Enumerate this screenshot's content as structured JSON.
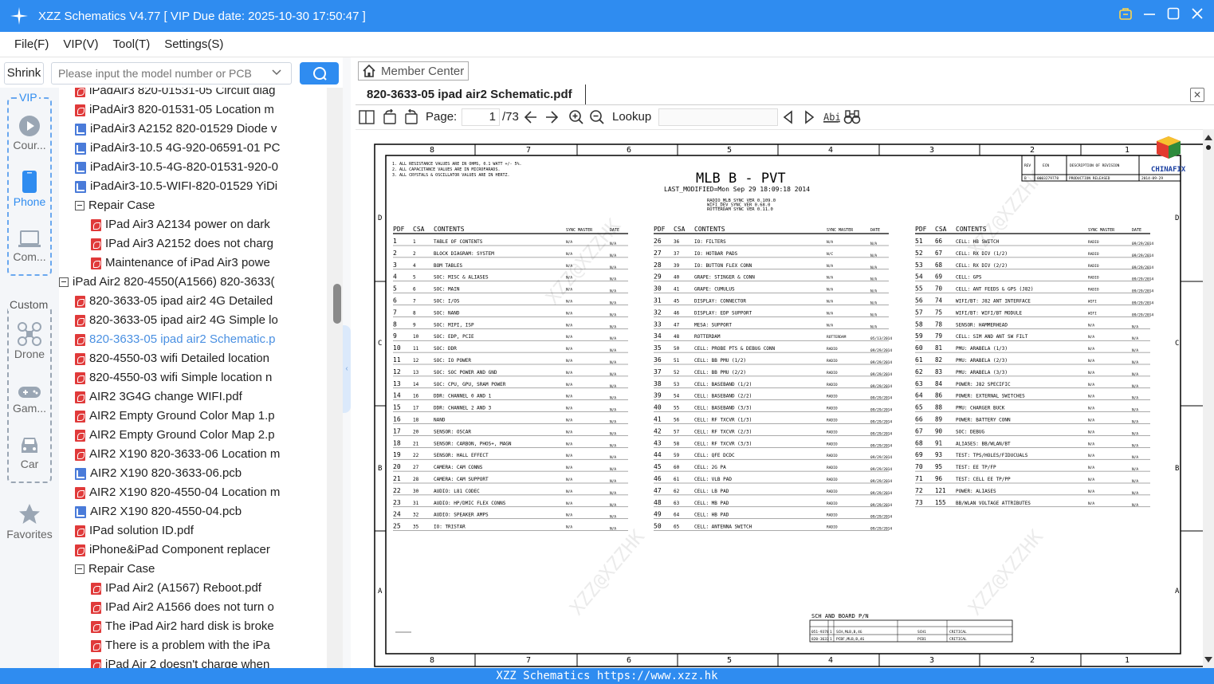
{
  "window": {
    "title": "XZZ Schematics V4.77 [ VIP Due date: 2025-10-30 17:50:47 ]"
  },
  "menu": [
    "File(F)",
    "VIP(V)",
    "Tool(T)",
    "Settings(S)"
  ],
  "search": {
    "shrink_label": "Shrink",
    "placeholder": "Please input the model number or PCB"
  },
  "sidebar": {
    "vip_label": "VIP",
    "custom_label": "Custom",
    "items": [
      {
        "label": "Cour...",
        "icon": "play-icon"
      },
      {
        "label": "Phone",
        "icon": "phone-icon"
      },
      {
        "label": "Com...",
        "icon": "laptop-icon"
      },
      {
        "label": "Drone",
        "icon": "drone-icon"
      },
      {
        "label": "Gam...",
        "icon": "gamepad-icon"
      },
      {
        "label": "Car",
        "icon": "car-icon"
      },
      {
        "label": "Favorites",
        "icon": "star-icon"
      }
    ]
  },
  "tree": {
    "rows": [
      {
        "label": "iPadAir3 820-01531-05 Circuit diag",
        "type": "pdf",
        "indent": 1
      },
      {
        "label": "iPadAir3 820-01531-05 Location m",
        "type": "pdf",
        "indent": 1
      },
      {
        "label": "iPadAir3 A2152 820-01529 Diode v",
        "type": "pcb",
        "indent": 1
      },
      {
        "label": "iPadAir3-10.5 4G-920-06591-01 PC",
        "type": "pcb",
        "indent": 1
      },
      {
        "label": "iPadAir3-10.5-4G-820-01531-920-0",
        "type": "pcb",
        "indent": 1
      },
      {
        "label": "iPadAir3-10.5-WIFI-820-01529 YiDi",
        "type": "pcb",
        "indent": 1
      },
      {
        "label": "Repair Case",
        "type": "folder",
        "indent": 1
      },
      {
        "label": "IPad Air3 A2134 power on dark",
        "type": "pdf",
        "indent": 2
      },
      {
        "label": "IPad Air3 A2152 does not charg",
        "type": "pdf",
        "indent": 2
      },
      {
        "label": "Maintenance of iPad Air3 powe",
        "type": "pdf",
        "indent": 2
      },
      {
        "label": "iPad Air2 820-4550(A1566) 820-3633(",
        "type": "folder",
        "indent": 0
      },
      {
        "label": "820-3633-05 ipad air2 4G Detailed",
        "type": "pdf",
        "indent": 1
      },
      {
        "label": "820-3633-05 ipad air2 4G Simple lo",
        "type": "pdf",
        "indent": 1
      },
      {
        "label": "820-3633-05 ipad air2 Schematic.p",
        "type": "pdf",
        "indent": 1,
        "selected": true
      },
      {
        "label": "820-4550-03 wifi Detailed location",
        "type": "pdf",
        "indent": 1
      },
      {
        "label": "820-4550-03 wifi Simple location n",
        "type": "pdf",
        "indent": 1
      },
      {
        "label": "AIR2 3G4G change WIFI.pdf",
        "type": "pdf",
        "indent": 1
      },
      {
        "label": "AIR2 Empty Ground Color Map 1.p",
        "type": "pdf",
        "indent": 1
      },
      {
        "label": "AIR2 Empty Ground Color Map 2.p",
        "type": "pdf",
        "indent": 1
      },
      {
        "label": "AIR2 X190 820-3633-06 Location m",
        "type": "pdf",
        "indent": 1
      },
      {
        "label": "AIR2 X190 820-3633-06.pcb",
        "type": "pcb",
        "indent": 1
      },
      {
        "label": "AIR2 X190 820-4550-04 Location m",
        "type": "pdf",
        "indent": 1
      },
      {
        "label": "AIR2 X190 820-4550-04.pcb",
        "type": "pcb",
        "indent": 1
      },
      {
        "label": "IPad solution ID.pdf",
        "type": "pdf",
        "indent": 1
      },
      {
        "label": "iPhone&iPad Component replacer",
        "type": "pdf",
        "indent": 1
      },
      {
        "label": "Repair Case",
        "type": "folder",
        "indent": 1
      },
      {
        "label": "IPad Air2 (A1567) Reboot.pdf",
        "type": "pdf",
        "indent": 2
      },
      {
        "label": "IPad Air2 A1566 does not turn o",
        "type": "pdf",
        "indent": 2
      },
      {
        "label": "The iPad Air2 hard disk is broke",
        "type": "pdf",
        "indent": 2
      },
      {
        "label": "There is a problem with the iPa",
        "type": "pdf",
        "indent": 2
      },
      {
        "label": "iPad Air 2 doesn't charge when",
        "type": "pdf",
        "indent": 2
      }
    ]
  },
  "viewer": {
    "member_center": "Member Center",
    "doc_title": "820-3633-05 ipad air2 Schematic.pdf",
    "page_label": "Page:",
    "page_value": "1",
    "page_total": "/73",
    "lookup_label": "Lookup",
    "lookup_value": ""
  },
  "schematic": {
    "title": "MLB B - PVT",
    "modified": "LAST_MODIFIED=Mon Sep 29 18:09:18 2014",
    "sync": [
      "RADIO_MLB SYNC VER 0.109.0",
      "WIFI_DEV SYNC VER 0.68.0",
      "ROTTERDAM SYNC VER 0.11.0"
    ],
    "notes": [
      "1. ALL RESISTANCE VALUES ARE IN OHMS, 0.1 WATT +/- 5%.",
      "2. ALL CAPACITANCE VALUES ARE IN MICROFARADS.",
      "3. ALL CRYSTALS & OSCILLATOR VALUES ARE IN HERTZ."
    ],
    "col_labels": [
      "8",
      "7",
      "6",
      "5",
      "4",
      "3",
      "2",
      "1"
    ],
    "row_labels": [
      "D",
      "C",
      "B",
      "A"
    ],
    "table_header": [
      "PDF",
      "CSA",
      "CONTENTS",
      "SYNC MASTER",
      "DATE"
    ],
    "rev_header": [
      "REV",
      "ECN",
      "DESCRIPTION OF REVISION"
    ],
    "rev_row": [
      "B",
      "0003279778",
      "PRODUCTION RELEASED",
      "2014-09-29"
    ],
    "brand": "CHINAFIX",
    "board_pn_title": "SCH AND BOARD P/N",
    "board_rows": [
      [
        "051-9378",
        "1",
        "SCH,MLB,B,4G",
        "SCH1",
        "CRITICAL"
      ],
      [
        "820-3633",
        "1",
        "PCBF,MLB,B,4G",
        "PCB1",
        "CRITICAL"
      ]
    ],
    "watermark": "XZZ@XZZHK",
    "col1": [
      [
        "1",
        "1",
        "TABLE OF CONTENTS",
        "N/A",
        "N/A"
      ],
      [
        "2",
        "2",
        "BLOCK DIAGRAM: SYSTEM",
        "N/A",
        "N/A"
      ],
      [
        "3",
        "4",
        "BOM TABLES",
        "N/A",
        "N/A"
      ],
      [
        "4",
        "5",
        "SOC: MISC & ALIASES",
        "N/A",
        "N/A"
      ],
      [
        "5",
        "6",
        "SOC: MAIN",
        "N/A",
        "N/A"
      ],
      [
        "6",
        "7",
        "SOC: I/OS",
        "N/A",
        "N/A"
      ],
      [
        "7",
        "8",
        "SOC: NAND",
        "N/A",
        "N/A"
      ],
      [
        "8",
        "9",
        "SOC: MIPI, ISP",
        "N/A",
        "N/A"
      ],
      [
        "9",
        "10",
        "SOC: EDP, PCIE",
        "N/A",
        "N/A"
      ],
      [
        "10",
        "11",
        "SOC: DDR",
        "N/A",
        "N/A"
      ],
      [
        "11",
        "12",
        "SOC: IO POWER",
        "N/A",
        "N/A"
      ],
      [
        "12",
        "13",
        "SOC: SOC POWER AND GND",
        "N/A",
        "N/A"
      ],
      [
        "13",
        "14",
        "SOC: CPU, GPU, SRAM POWER",
        "N/A",
        "N/A"
      ],
      [
        "14",
        "16",
        "DDR: CHANNEL 0 AND 1",
        "N/A",
        "N/A"
      ],
      [
        "15",
        "17",
        "DDR: CHANNEL 2 AND 3",
        "N/A",
        "N/A"
      ],
      [
        "16",
        "18",
        "NAND",
        "N/A",
        "N/A"
      ],
      [
        "17",
        "20",
        "SENSOR: OSCAR",
        "N/A",
        "N/A"
      ],
      [
        "18",
        "21",
        "SENSOR: CARBON, PHOS+, MAGN",
        "N/A",
        "N/A"
      ],
      [
        "19",
        "22",
        "SENSOR: HALL EFFECT",
        "N/A",
        "N/A"
      ],
      [
        "20",
        "27",
        "CAMERA: CAM CONNS",
        "N/A",
        "N/A"
      ],
      [
        "21",
        "28",
        "CAMERA: CAM SUPPORT",
        "N/A",
        "N/A"
      ],
      [
        "22",
        "30",
        "AUDIO: L81 CODEC",
        "N/A",
        "N/A"
      ],
      [
        "23",
        "31",
        "AUDIO: HP/DMIC FLEX CONNS",
        "N/A",
        "N/A"
      ],
      [
        "24",
        "32",
        "AUDIO: SPEAKER AMPS",
        "N/A",
        "N/A"
      ],
      [
        "25",
        "35",
        "IO: TRISTAR",
        "N/A",
        "N/A"
      ]
    ],
    "col2": [
      [
        "26",
        "36",
        "IO: FILTERS",
        "N/A",
        "N/A"
      ],
      [
        "27",
        "37",
        "IO: HOTBAR PADS",
        "N/C",
        "N/A"
      ],
      [
        "28",
        "39",
        "IO: BUTTON FLEX CONN",
        "N/A",
        "N/A"
      ],
      [
        "29",
        "40",
        "GRAPE: STINGER & CONN",
        "N/A",
        "N/A"
      ],
      [
        "30",
        "41",
        "GRAPE: CUMULUS",
        "N/A",
        "N/A"
      ],
      [
        "31",
        "45",
        "DISPLAY: CONNECTOR",
        "N/A",
        "N/A"
      ],
      [
        "32",
        "46",
        "DISPLAY: EDP SUPPORT",
        "N/A",
        "N/A"
      ],
      [
        "33",
        "47",
        "MESA: SUPPORT",
        "N/A",
        "N/A"
      ],
      [
        "34",
        "48",
        "ROTTERDAM",
        "ROTTERDAM",
        "05/13/2014"
      ],
      [
        "35",
        "50",
        "CELL: PROBE PTS & DEBUG CONN",
        "RADIO",
        "09/29/2014"
      ],
      [
        "36",
        "51",
        "CELL: BB PMU (1/2)",
        "RADIO",
        "09/29/2014"
      ],
      [
        "37",
        "52",
        "CELL: BB PMU (2/2)",
        "RADIO",
        "09/29/2014"
      ],
      [
        "38",
        "53",
        "CELL: BASEBAND (1/2)",
        "RADIO",
        "09/29/2014"
      ],
      [
        "39",
        "54",
        "CELL: BASEBAND (2/2)",
        "RADIO",
        "09/29/2014"
      ],
      [
        "40",
        "55",
        "CELL: BASEBAND (3/3)",
        "RADIO",
        "09/29/2014"
      ],
      [
        "41",
        "56",
        "CELL: RF TXCVR (1/3)",
        "RADIO",
        "09/29/2014"
      ],
      [
        "42",
        "57",
        "CELL: RF TXCVR (2/3)",
        "RADIO",
        "09/29/2014"
      ],
      [
        "43",
        "58",
        "CELL: RF TXCVR (3/3)",
        "RADIO",
        "09/29/2014"
      ],
      [
        "44",
        "59",
        "CELL: QFE DCDC",
        "RADIO",
        "09/29/2014"
      ],
      [
        "45",
        "60",
        "CELL: 2G PA",
        "RADIO",
        "09/29/2014"
      ],
      [
        "46",
        "61",
        "CELL: VLB PAD",
        "RADIO",
        "09/29/2014"
      ],
      [
        "47",
        "62",
        "CELL: LB PAD",
        "RADIO",
        "09/29/2014"
      ],
      [
        "48",
        "63",
        "CELL: MB PAD",
        "RADIO",
        "09/29/2014"
      ],
      [
        "49",
        "64",
        "CELL: HB PAD",
        "RADIO",
        "09/29/2014"
      ],
      [
        "50",
        "65",
        "CELL: ANTENNA SWITCH",
        "RADIO",
        "09/29/2014"
      ]
    ],
    "col3": [
      [
        "51",
        "66",
        "CELL: HB SWITCH",
        "RADIO",
        "09/29/2014"
      ],
      [
        "52",
        "67",
        "CELL: RX DIV (1/2)",
        "RADIO",
        "09/29/2014"
      ],
      [
        "53",
        "68",
        "CELL: RX DIV (2/2)",
        "RADIO",
        "09/29/2014"
      ],
      [
        "54",
        "69",
        "CELL: GPS",
        "RADIO",
        "09/29/2014"
      ],
      [
        "55",
        "70",
        "CELL: ANT FEEDS & GPS (J82)",
        "RADIO",
        "09/29/2014"
      ],
      [
        "56",
        "74",
        "WIFI/BT: J82 ANT INTERFACE",
        "WIFI",
        "09/29/2014"
      ],
      [
        "57",
        "75",
        "WIFI/BT: WIFI/BT MODULE",
        "WIFI",
        "09/29/2014"
      ],
      [
        "58",
        "78",
        "SENSOR: HAMMERHEAD",
        "N/A",
        "N/A"
      ],
      [
        "59",
        "79",
        "CELL: SIM AND ANT SW FILT",
        "N/A",
        "N/A"
      ],
      [
        "60",
        "81",
        "PMU: ARABELA (1/3)",
        "N/A",
        "N/A"
      ],
      [
        "61",
        "82",
        "PMU: ARABELA (2/3)",
        "N/A",
        "N/A"
      ],
      [
        "62",
        "83",
        "PMU: ARABELA (3/3)",
        "N/A",
        "N/A"
      ],
      [
        "63",
        "84",
        "POWER: J82 SPECIFIC",
        "N/A",
        "N/A"
      ],
      [
        "64",
        "86",
        "POWER: EXTERNAL SWITCHES",
        "N/A",
        "N/A"
      ],
      [
        "65",
        "88",
        "PMU: CHARGER BUCK",
        "N/A",
        "N/A"
      ],
      [
        "66",
        "89",
        "POWER: BATTERY CONN",
        "N/A",
        "N/A"
      ],
      [
        "67",
        "90",
        "SOC: DEBUG",
        "N/A",
        "N/A"
      ],
      [
        "68",
        "91",
        "ALIASES: BB/WLAN/BT",
        "N/A",
        "N/A"
      ],
      [
        "69",
        "93",
        "TEST: TPS/HOLES/FIDUCUALS",
        "N/A",
        "N/A"
      ],
      [
        "70",
        "95",
        "TEST: EE TP/FP",
        "N/A",
        "N/A"
      ],
      [
        "71",
        "96",
        "TEST: CELL EE TP/PP",
        "N/A",
        "N/A"
      ],
      [
        "72",
        "121",
        "POWER: ALIASES",
        "N/A",
        "N/A"
      ],
      [
        "73",
        "155",
        "BB/WLAN VOLTAGE ATTRIBUTES",
        "N/A",
        "N/A"
      ]
    ]
  },
  "status": {
    "text": "XZZ Schematics https://www.xzz.hk"
  },
  "colors": {
    "accent": "#2f8cf0",
    "selected_text": "#4a90e2",
    "pdf_icon": "#e03a3a",
    "pcb_icon": "#4a7bd9"
  }
}
